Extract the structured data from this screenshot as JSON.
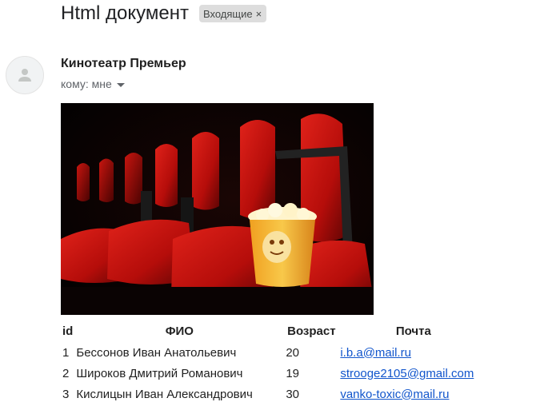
{
  "email": {
    "subject": "Html документ",
    "label_chip": "Входящие",
    "label_chip_close": "×",
    "sender": "Кинотеатр Премьер",
    "recipient": "кому: мне",
    "avatar_icon": "person-icon",
    "table": {
      "headers": [
        "id",
        "ФИО",
        "Возраст",
        "Почта"
      ],
      "rows": [
        [
          "1",
          "Бессонов Иван Анатольевич",
          "20",
          "i.b.a@mail.ru"
        ],
        [
          "2",
          "Широков Дмитрий Романович",
          "19",
          "strooge2105@gmail.com"
        ],
        [
          "3",
          "Кислицын Иван Александрович",
          "30",
          "vanko-toxic@mail.ru"
        ]
      ]
    }
  },
  "colors": {
    "link": "#1155cc",
    "seat_red": "#c4100c",
    "chip_bg": "#dddddd"
  }
}
